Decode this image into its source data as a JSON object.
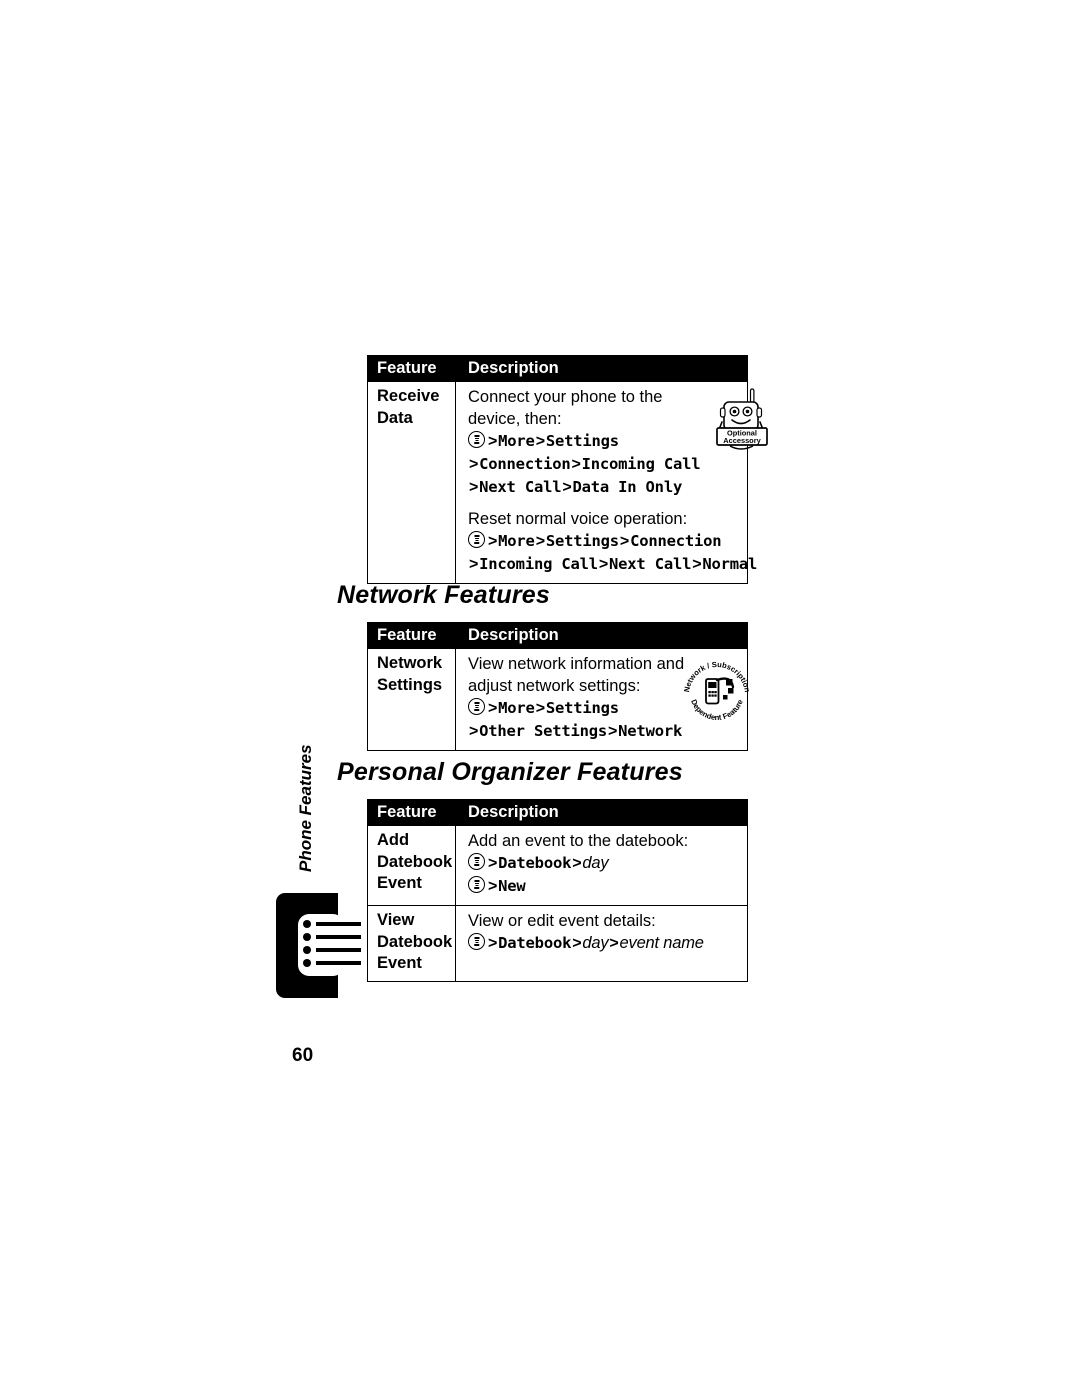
{
  "document": {
    "page_number": "60",
    "side_tab_label": "Phone Features"
  },
  "icons": {
    "menu_key": "menu-key-icon",
    "optional_accessory": {
      "name": "optional-accessory-icon",
      "line1": "Optional",
      "line2": "Accessory"
    },
    "network_badge": {
      "name": "network-subscription-dependent-feature-icon",
      "top_arc": "Network / Subscription",
      "bottom_arc": "Dependent  Feature"
    }
  },
  "tables": [
    {
      "id": "data-features-table",
      "headers": {
        "feature": "Feature",
        "description": "Description"
      },
      "rows": [
        {
          "feature_lines": [
            "Receive",
            "Data"
          ],
          "badge": "optional_accessory",
          "blocks": [
            {
              "type": "plain_lines",
              "lines": [
                "Connect your phone to the",
                "device, then:"
              ]
            },
            {
              "type": "path_lines",
              "lines": [
                {
                  "menu_key": true,
                  "segments": [
                    "More",
                    "Settings"
                  ]
                },
                {
                  "menu_key": false,
                  "segments": [
                    "Connection",
                    "Incoming Call"
                  ]
                },
                {
                  "menu_key": false,
                  "segments": [
                    "Next Call",
                    "Data In Only"
                  ]
                }
              ]
            },
            {
              "type": "gap"
            },
            {
              "type": "plain_lines",
              "lines": [
                "Reset normal voice operation:"
              ]
            },
            {
              "type": "path_lines",
              "lines": [
                {
                  "menu_key": true,
                  "segments": [
                    "More",
                    "Settings",
                    "Connection"
                  ]
                },
                {
                  "menu_key": false,
                  "segments": [
                    "Incoming Call",
                    "Next Call",
                    "Normal"
                  ]
                }
              ]
            }
          ]
        }
      ]
    },
    {
      "id": "network-features-table",
      "heading": "Network Features",
      "headers": {
        "feature": "Feature",
        "description": "Description"
      },
      "rows": [
        {
          "feature_lines": [
            "Network",
            "Settings"
          ],
          "badge": "network_badge",
          "blocks": [
            {
              "type": "plain_lines",
              "lines": [
                "View network information and",
                "adjust network settings:"
              ]
            },
            {
              "type": "path_lines",
              "lines": [
                {
                  "menu_key": true,
                  "segments": [
                    "More",
                    "Settings"
                  ]
                },
                {
                  "menu_key": false,
                  "segments": [
                    "Other Settings",
                    "Network"
                  ]
                }
              ]
            }
          ]
        }
      ]
    },
    {
      "id": "personal-organizer-features-table",
      "heading": "Personal Organizer Features",
      "headers": {
        "feature": "Feature",
        "description": "Description"
      },
      "rows": [
        {
          "feature_lines": [
            "Add",
            "Datebook",
            "Event"
          ],
          "blocks": [
            {
              "type": "plain_lines",
              "lines": [
                "Add an event to the datebook:"
              ]
            },
            {
              "type": "path_lines",
              "lines": [
                {
                  "menu_key": true,
                  "segments": [
                    "Datebook"
                  ],
                  "trailing_var": "day"
                },
                {
                  "menu_key": true,
                  "segments": [
                    "New"
                  ]
                }
              ]
            }
          ]
        },
        {
          "feature_lines": [
            "View",
            "Datebook",
            "Event"
          ],
          "blocks": [
            {
              "type": "plain_lines",
              "lines": [
                "View or edit event details:"
              ]
            },
            {
              "type": "path_lines",
              "lines": [
                {
                  "menu_key": true,
                  "segments": [
                    "Datebook"
                  ],
                  "trailing_vars": [
                    "day",
                    "event name"
                  ]
                }
              ]
            }
          ]
        }
      ]
    }
  ]
}
